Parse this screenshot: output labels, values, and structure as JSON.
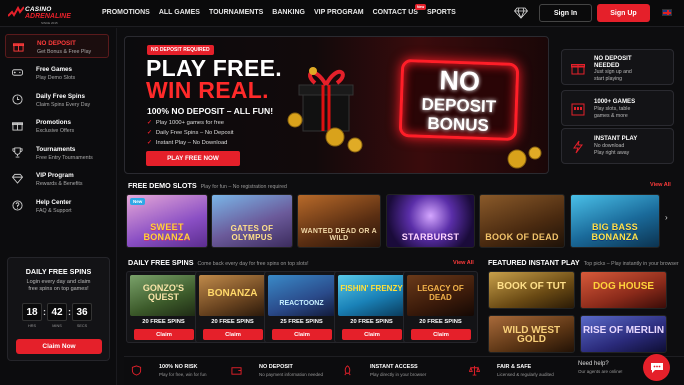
{
  "brand": {
    "line1": "CASINO",
    "line2": "ADRENALINE",
    "since": "SINCE 2015"
  },
  "nav": [
    "PROMOTIONS",
    "ALL GAMES",
    "TOURNAMENTS",
    "BANKING",
    "VIP PROGRAM",
    "CONTACT US",
    "SPORTS"
  ],
  "nav_badge": "New",
  "auth": {
    "sign_in": "Sign In",
    "sign_up": "Sign Up"
  },
  "sidebar": [
    {
      "title": "NO DEPOSIT",
      "sub": "Get Bonus & Free Play",
      "icon": "gift-icon"
    },
    {
      "title": "Free Games",
      "sub": "Play Demo Slots",
      "icon": "gamepad-icon"
    },
    {
      "title": "Daily Free Spins",
      "sub": "Claim Spins Every Day",
      "icon": "clock-icon"
    },
    {
      "title": "Promotions",
      "sub": "Exclusive Offers",
      "icon": "gift-icon"
    },
    {
      "title": "Tournaments",
      "sub": "Free Entry Tournaments",
      "icon": "trophy-icon"
    },
    {
      "title": "VIP Program",
      "sub": "Rewards & Benefits",
      "icon": "diamond-icon"
    },
    {
      "title": "Help Center",
      "sub": "FAQ & Support",
      "icon": "help-icon"
    }
  ],
  "daily_spins": {
    "title": "DAILY FREE SPINS",
    "desc1": "Login every day and claim",
    "desc2": "free spins on top games!",
    "hrs": "18",
    "mins": "42",
    "secs": "36",
    "hrs_label": "HRS",
    "mins_label": "MINS",
    "secs_label": "SECS",
    "cta": "Claim Now"
  },
  "hero": {
    "badge": "NO DEPOSIT REQUIRED",
    "line1": "PLAY FREE.",
    "line2": "WIN REAL.",
    "line3": "100% NO DEPOSIT – ALL FUN!",
    "bullets": [
      "Play 1000+ games for free",
      "Daily Free Spins – No Deposit",
      "Instant Play – No Download"
    ],
    "cta": "PLAY FREE NOW",
    "sign": [
      "NO",
      "DEPOSIT",
      "BONUS"
    ]
  },
  "right_cards": [
    {
      "title": "NO DEPOSIT",
      "sub": [
        "NEEDED",
        "Just sign up and",
        "start playing"
      ],
      "icon": "gift-icon"
    },
    {
      "title": "1000+ GAMES",
      "sub": [
        "Play slots, table",
        "games & more"
      ],
      "icon": "slot-machine-icon"
    },
    {
      "title": "INSTANT PLAY",
      "sub": [
        "No download",
        "Play right away"
      ],
      "icon": "lightning-icon"
    }
  ],
  "demo": {
    "title": "FREE DEMO SLOTS",
    "subtitle": "Play for fun – No registration required",
    "view_all": "View All",
    "new_badge": "New",
    "games": [
      "SWEET BONANZA",
      "GATES OF OLYMPUS",
      "WANTED DEAD OR A WILD",
      "STARBURST",
      "BOOK OF DEAD",
      "BIG BASS BONANZA"
    ]
  },
  "spins": {
    "title": "DAILY FREE SPINS",
    "subtitle": "Come back every day for free spins on top slots!",
    "view_all": "View All",
    "games": [
      {
        "name": "GONZO'S QUEST",
        "spins": "20 FREE SPINS"
      },
      {
        "name": "BONANZA",
        "spins": "20 FREE SPINS"
      },
      {
        "name": "REACTOONZ",
        "spins": "25 FREE SPINS"
      },
      {
        "name": "FISHIN' FRENZY",
        "spins": "20 FREE SPINS"
      },
      {
        "name": "LEGACY OF DEAD",
        "spins": "20 FREE SPINS"
      }
    ],
    "claim": "Claim"
  },
  "instant": {
    "title": "FEATURED INSTANT PLAY",
    "subtitle": "Top picks – Play instantly in your browser",
    "games": [
      "BOOK OF TUT",
      "DOG HOUSE",
      "WILD WEST GOLD",
      "RISE OF MERLIN"
    ]
  },
  "footer": [
    {
      "title": "100% NO RISK",
      "sub": "Play for free, win for fun",
      "icon": "shield-icon"
    },
    {
      "title": "NO DEPOSIT",
      "sub": "No payment information needed",
      "icon": "wallet-icon"
    },
    {
      "title": "INSTANT ACCESS",
      "sub": "Play directly in your browser",
      "icon": "rocket-icon"
    },
    {
      "title": "FAIR & SAFE",
      "sub": "Licensed & regularly audited",
      "icon": "scales-icon"
    }
  ],
  "help": {
    "title": "Need help?",
    "sub": "Our agents are online!"
  },
  "colors": {
    "accent": "#e5202a",
    "bg": "#0d0d0f"
  }
}
